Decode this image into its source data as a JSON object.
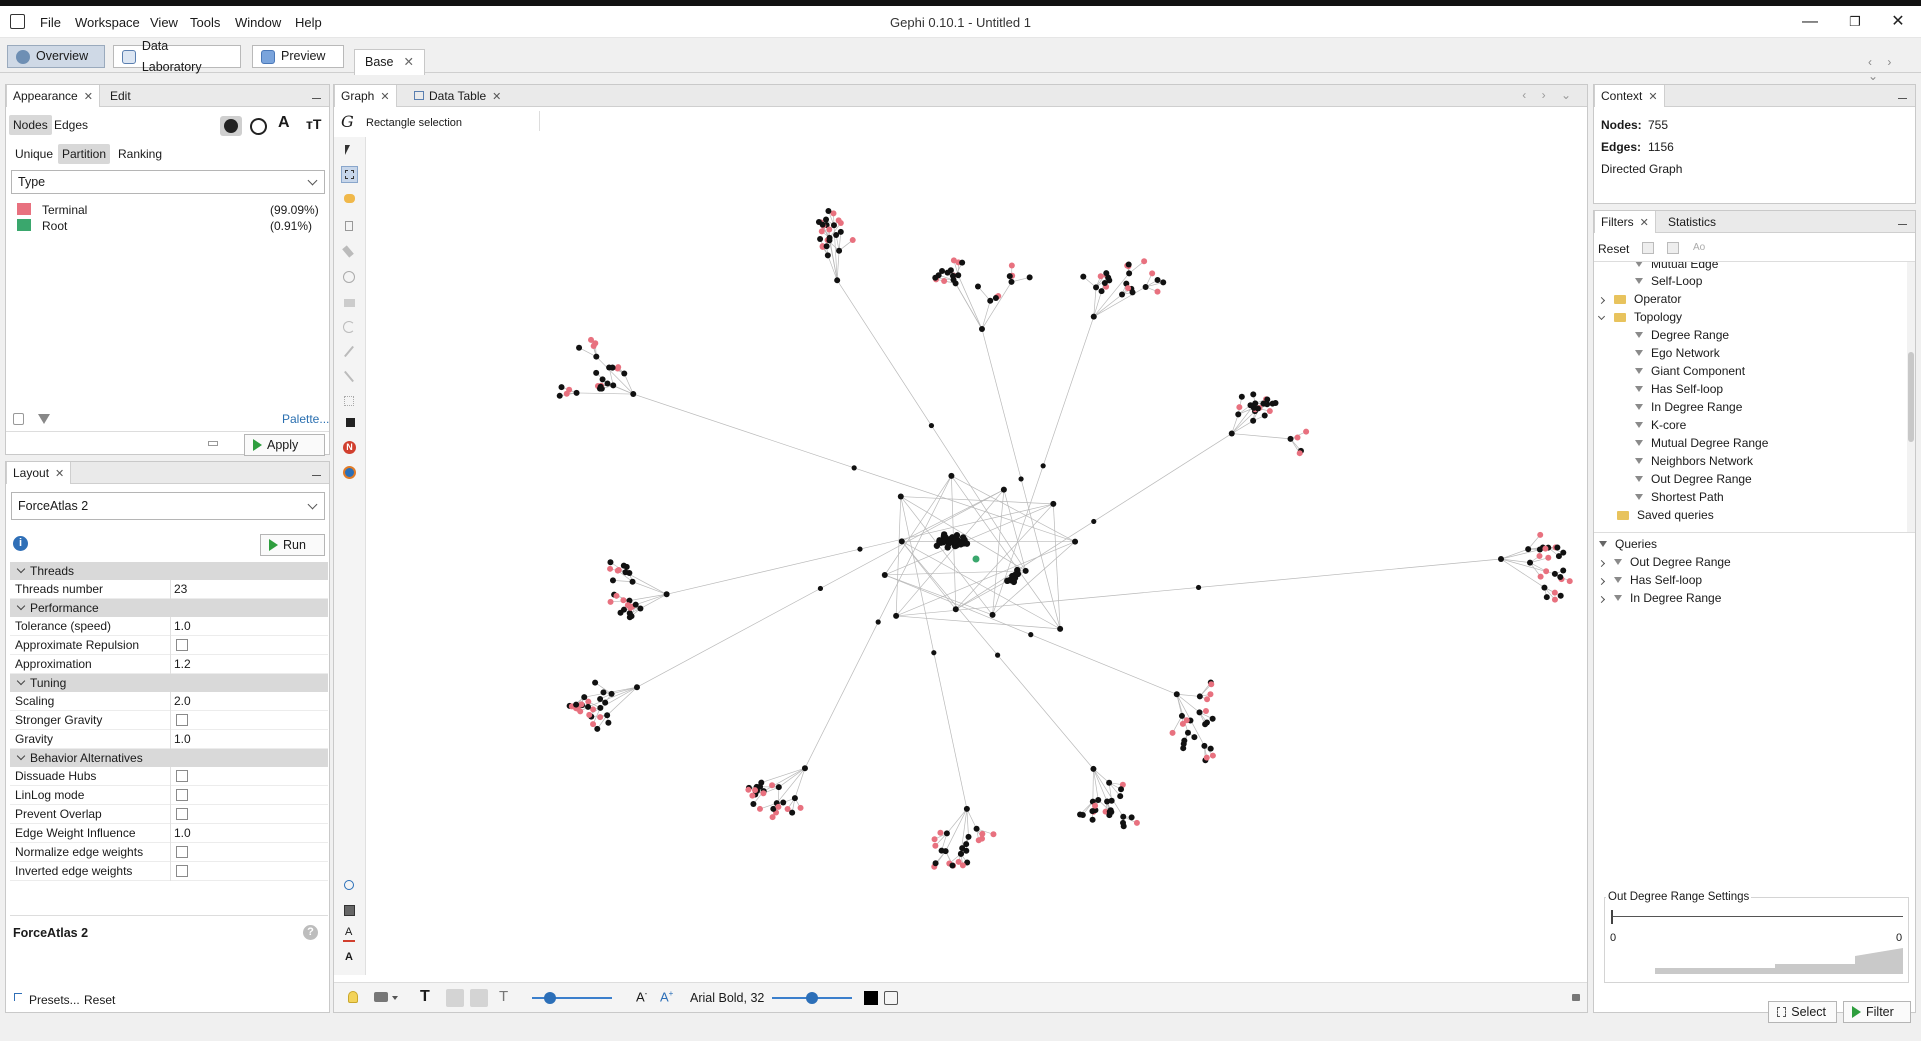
{
  "window": {
    "title": "Gephi 0.10.1 - Untitled 1"
  },
  "menu": [
    "File",
    "Workspace",
    "View",
    "Tools",
    "Window",
    "Help"
  ],
  "workspace_tabs": {
    "overview": "Overview",
    "data_lab": "Data Laboratory",
    "preview": "Preview"
  },
  "document_tab": "Base",
  "appearance": {
    "tab": "Appearance",
    "edit_tab": "Edit",
    "element_tabs": [
      "Nodes",
      "Edges"
    ],
    "mode_tabs": [
      "Unique",
      "Partition",
      "Ranking"
    ],
    "attribute": "Type",
    "partitions": [
      {
        "label": "Terminal",
        "pct": "(99.09%)",
        "color": "#e8717f"
      },
      {
        "label": "Root",
        "pct": "(0.91%)",
        "color": "#3aa76d"
      }
    ],
    "palette": "Palette...",
    "apply": "Apply"
  },
  "layout": {
    "tab": "Layout",
    "algorithm": "ForceAtlas 2",
    "run": "Run",
    "cat_threads": "Threads",
    "cat_performance": "Performance",
    "cat_tuning": "Tuning",
    "cat_behavior": "Behavior Alternatives",
    "props": {
      "threads": {
        "k": "Threads number",
        "v": "23"
      },
      "tolerance": {
        "k": "Tolerance (speed)",
        "v": "1.0"
      },
      "approx_rep": {
        "k": "Approximate Repulsion"
      },
      "approximation": {
        "k": "Approximation",
        "v": "1.2"
      },
      "scaling": {
        "k": "Scaling",
        "v": "2.0"
      },
      "stronger": {
        "k": "Stronger Gravity"
      },
      "gravity": {
        "k": "Gravity",
        "v": "1.0"
      },
      "dissuade": {
        "k": "Dissuade Hubs"
      },
      "linlog": {
        "k": "LinLog mode"
      },
      "overlap": {
        "k": "Prevent Overlap"
      },
      "ewi": {
        "k": "Edge Weight Influence",
        "v": "1.0"
      },
      "normalize": {
        "k": "Normalize edge weights"
      },
      "inverted": {
        "k": "Inverted edge weights"
      }
    },
    "description_title": "ForceAtlas 2",
    "presets": "Presets...",
    "reset": "Reset"
  },
  "graph": {
    "tab": "Graph",
    "data_table_tab": "Data Table",
    "selection_mode": "Rectangle selection",
    "font_label": "Arial Bold, 32"
  },
  "context": {
    "tab": "Context",
    "nodes_label": "Nodes:",
    "nodes": "755",
    "edges_label": "Edges:",
    "edges": "1156",
    "graph_type": "Directed Graph"
  },
  "filters": {
    "tab": "Filters",
    "stats_tab": "Statistics",
    "reset": "Reset",
    "tree": {
      "mutual_edge": "Mutual Edge",
      "self_loop": "Self-Loop",
      "operator": "Operator",
      "topology": "Topology",
      "degree_range": "Degree Range",
      "ego": "Ego Network",
      "giant": "Giant Component",
      "has_self_loop": "Has Self-loop",
      "in_degree": "In Degree Range",
      "kcore": "K-core",
      "mutual_degree": "Mutual Degree Range",
      "neighbors": "Neighbors Network",
      "out_degree": "Out Degree Range",
      "shortest": "Shortest Path",
      "saved": "Saved queries"
    },
    "queries_label": "Queries",
    "queries": [
      "Out Degree Range",
      "Has Self-loop",
      "In Degree Range"
    ],
    "settings_title": "Out Degree Range Settings",
    "range_min": "0",
    "range_max": "0",
    "select": "Select",
    "filter": "Filter"
  },
  "colors": {
    "terminal": "#e8717f",
    "root": "#3aa76d",
    "node": "#111111",
    "edge": "#b9b9b9"
  }
}
